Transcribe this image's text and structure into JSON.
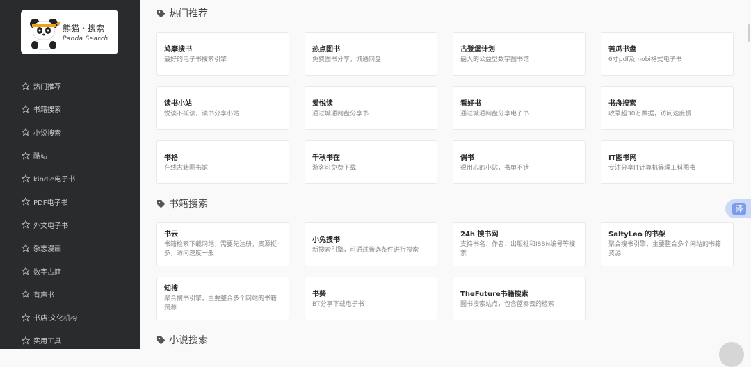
{
  "logo": {
    "title": "熊猫・搜索",
    "subtitle": "Panda Search"
  },
  "sidebar": {
    "items": [
      {
        "label": "热门推荐"
      },
      {
        "label": "书籍搜索"
      },
      {
        "label": "小说搜索"
      },
      {
        "label": "酷站"
      },
      {
        "label": "kindle电子书"
      },
      {
        "label": "PDF电子书"
      },
      {
        "label": "外文电子书"
      },
      {
        "label": "杂志漫画"
      },
      {
        "label": "数字古籍"
      },
      {
        "label": "有声书"
      },
      {
        "label": "书店·文化机构"
      },
      {
        "label": "实用工具"
      }
    ]
  },
  "sections": [
    {
      "title": "热门推荐",
      "cards": [
        {
          "title": "鸠摩搜书",
          "desc": "最好的电子书搜索引擎"
        },
        {
          "title": "热点图书",
          "desc": "免费图书分享，城通网盘"
        },
        {
          "title": "古登堡计划",
          "desc": "最大的公益型数字图书馆"
        },
        {
          "title": "苦瓜书盘",
          "desc": "6寸pdf及mobi格式电子书"
        },
        {
          "title": "读书小站",
          "desc": "悦读不孤读，读书分享小站"
        },
        {
          "title": "爱悦读",
          "desc": "通过城通网盘分享书"
        },
        {
          "title": "看好书",
          "desc": "通过城通网盘分享电子书"
        },
        {
          "title": "书舟搜索",
          "desc": "收录超30万数据，访问速度慢"
        },
        {
          "title": "书格",
          "desc": "在线古籍图书馆"
        },
        {
          "title": "千秋书在",
          "desc": "游客可免费下载"
        },
        {
          "title": "偶书",
          "desc": "很用心的小站，书单不错"
        },
        {
          "title": "IT图书网",
          "desc": "专注分享IT计算机等理工科图书"
        }
      ]
    },
    {
      "title": "书籍搜索",
      "cards": [
        {
          "title": "书云",
          "desc": "书籍检索下载网站，需要先注册，资源挺多，访问速度一般"
        },
        {
          "title": "小兔搜书",
          "desc": "新搜索引擎，可通过筛选条件进行搜索"
        },
        {
          "title": "24h 搜书网",
          "desc": "支持书名、作者、出版社和ISBN编号等搜索"
        },
        {
          "title": "SaltyLeo 的书架",
          "desc": "聚合搜书引擎，主要整合多个网站的书籍资源"
        },
        {
          "title": "知搜",
          "desc": "聚合搜书引擎，主要整合多个网站的书籍资源"
        },
        {
          "title": "书葵",
          "desc": "BT分享下载电子书"
        },
        {
          "title": "TheFuture书籍搜索",
          "desc": "图书搜索站点，包含蓝奏云的检索"
        }
      ]
    },
    {
      "title": "小说搜索"
    }
  ],
  "translate_label": "译",
  "colors": {
    "sidebar_bg": "#2a2b2d",
    "page_bg": "#f9f9f9",
    "translate_accent": "#7d9ce8"
  }
}
